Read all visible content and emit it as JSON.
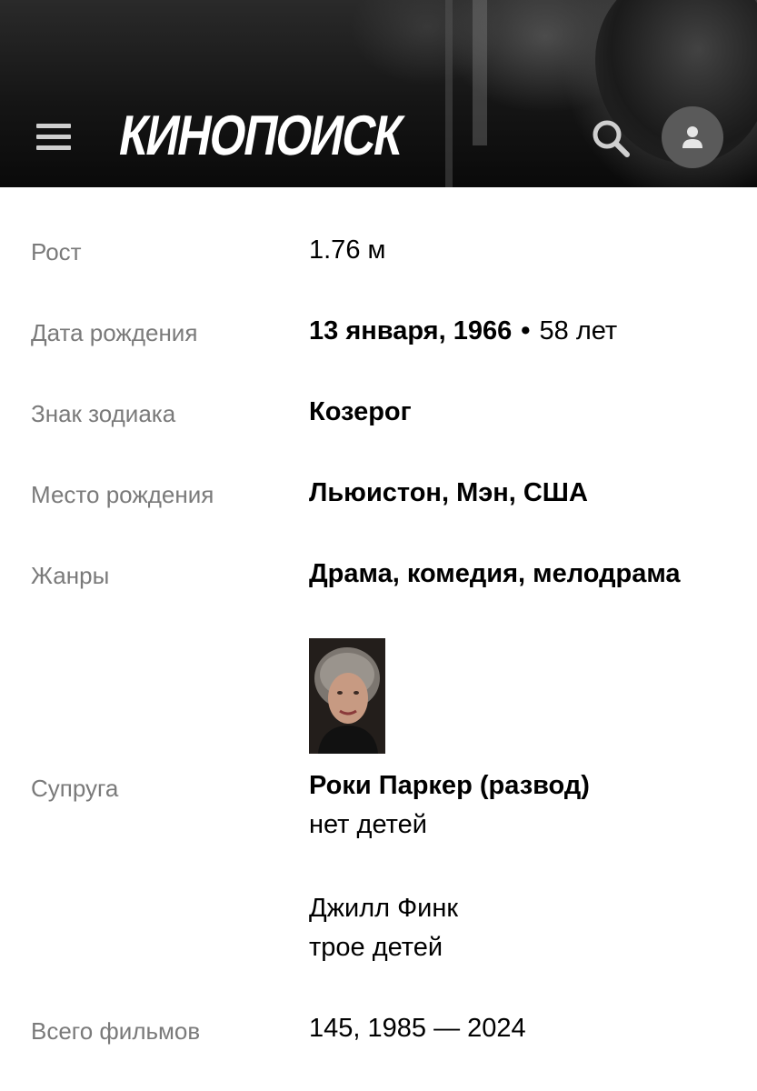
{
  "header": {
    "logo_text": "КИНОПОИСК",
    "menu_icon": "hamburger-menu-icon",
    "search_icon": "search-icon",
    "profile_icon": "user-icon"
  },
  "info": {
    "height": {
      "label": "Рост",
      "value": "1.76 м"
    },
    "birth_date": {
      "label": "Дата рождения",
      "date": "13 января, 1966",
      "separator": "•",
      "age": "58 лет"
    },
    "zodiac": {
      "label": "Знак зодиака",
      "value": "Козерог"
    },
    "birth_place": {
      "label": "Место рождения",
      "value": "Льюистон, Мэн, США"
    },
    "genres": {
      "label": "Жанры",
      "value": "Драма, комедия, мелодрама"
    },
    "spouse": {
      "label": "Супруга",
      "entries": [
        {
          "name": "Роки Паркер (развод)",
          "children": "нет детей"
        },
        {
          "name": "Джилл Финк",
          "children": "трое детей"
        }
      ]
    },
    "films": {
      "label": "Всего фильмов",
      "value": "145, 1985 — 2024"
    }
  },
  "colors": {
    "label": "#7a7a7a",
    "value": "#000000",
    "avatar_bg": "#5a5a5a"
  }
}
